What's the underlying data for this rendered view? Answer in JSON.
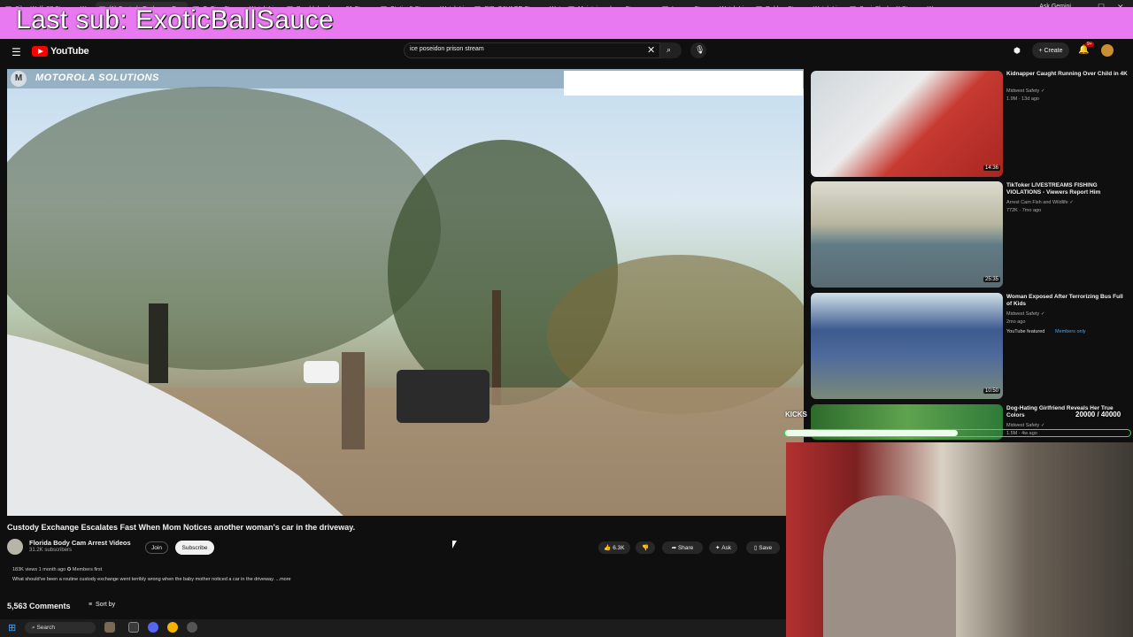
{
  "browser": {
    "tabs": [
      {
        "label": "SilverWolf_27 Stream - Wa"
      },
      {
        "label": "(1) Custody Exchange E"
      },
      {
        "label": "OxFive Stream - Watch Li"
      },
      {
        "label": "Bumblebeefarmer81 Stream"
      },
      {
        "label": "Station5 Stream - Watch Li"
      },
      {
        "label": "SIR_SAVAGE Stream - Watc"
      },
      {
        "label": "Maintainyadame Stream - "
      },
      {
        "label": "Looonn Stream - Watch Li"
      },
      {
        "label": "Ruhhnr Stream - Watch Li"
      },
      {
        "label": "SonicSlasherX Stream - W"
      }
    ],
    "ask_gemini": "Ask Gemini"
  },
  "overlay": {
    "text": "Last sub: ExoticBallSauce",
    "bar_color": "#e879f0"
  },
  "header": {
    "logo_text": "YouTube",
    "search_value": "ice poseidon prison stream",
    "create_label": "+ Create",
    "notif_count": "9+"
  },
  "video": {
    "watermark_text": "MOTOROLA SOLUTIONS",
    "title": "Custody Exchange Escalates Fast When Mom Notices another woman's car in the driveway.",
    "channel": "Florida Body Cam Arrest Videos",
    "subscribers": "31.2K subscribers",
    "join_label": "Join",
    "subscribe_label": "Subscribe",
    "likes": "6.3K",
    "share_label": "Share",
    "ask_label": "Ask",
    "save_label": "Save",
    "meta": "183K views  1 month ago  ✪ Members first",
    "description": "What should've been a routine custody exchange went terribly wrong when the baby mother noticed a car in the driveway. ...more",
    "comments": "5,563 Comments",
    "sort_label": "Sort by"
  },
  "recommendations": [
    {
      "title": "Kidnapper Caught Running Over Child in 4K",
      "channel": "Midwest Safety ✓",
      "meta": "1.9M · 13d ago",
      "duration": "14:36"
    },
    {
      "title": "TikToker LIVESTREAMS FISHING VIOLATIONS - Viewers Report Him",
      "channel": "Arrest Cam Fish and Wildlife ✓",
      "meta": "772K · 7mo ago",
      "duration": "25:35"
    },
    {
      "title": "Woman Exposed After Terrorizing Bus Full of Kids",
      "channel": "Midwest Safety ✓",
      "meta": "2mo ago",
      "extra": "YouTube featured",
      "badge": "Members only",
      "duration": "10:50"
    },
    {
      "title": "Dog-Hating Girlfriend Reveals Her True Colors",
      "channel": "Midwest Safety ✓",
      "meta": "1.5M · 4w ago"
    }
  ],
  "subgoal": {
    "label": "KICKS",
    "progress_text": "20000 / 40000",
    "progress": 0.5
  },
  "taskbar": {
    "search_placeholder": "Search"
  }
}
